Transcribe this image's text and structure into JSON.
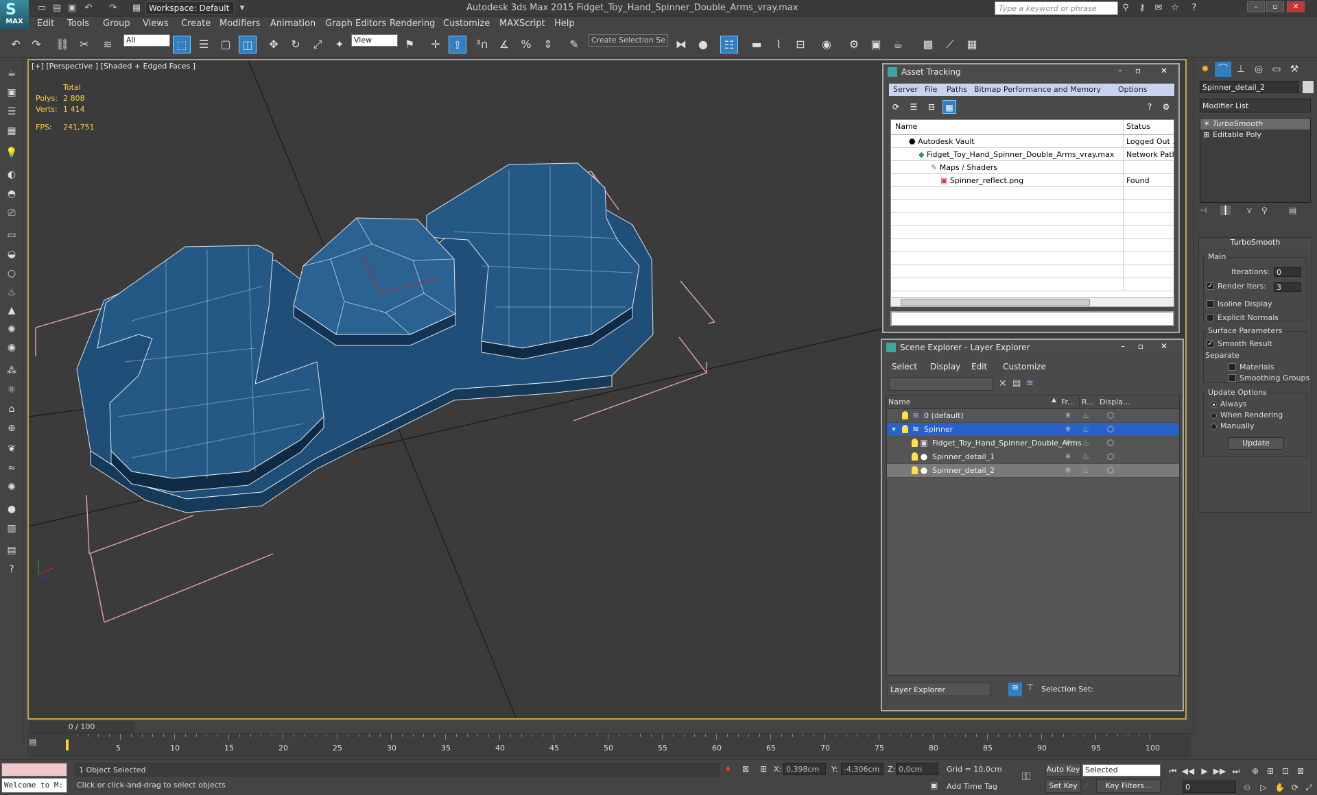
{
  "titlebar": {
    "app_name": "MAX",
    "workspace": "Workspace: Default",
    "window_title": "Autodesk 3ds Max 2015     Fidget_Toy_Hand_Spinner_Double_Arms_vray.max",
    "search_placeholder": "Type a keyword or phrase"
  },
  "menu": [
    "Edit",
    "Tools",
    "Group",
    "Views",
    "Create",
    "Modifiers",
    "Animation",
    "Graph Editors",
    "Rendering",
    "Customize",
    "MAXScript",
    "Help"
  ],
  "toolbar": {
    "selection_filter": "All",
    "ref_coord": "View",
    "selection_set": "Create Selection Se"
  },
  "viewport": {
    "label": "[+] [Perspective ] [Shaded + Edged Faces ]",
    "stats_header": "Total",
    "polys_label": "Polys:",
    "polys_value": "2 808",
    "verts_label": "Verts:",
    "verts_value": "1 414",
    "fps_label": "FPS:",
    "fps_value": "241,751",
    "model_color": "#1f4f78"
  },
  "asset_tracking": {
    "title": "Asset Tracking",
    "menu": [
      "Server",
      "File",
      "Paths",
      "Bitmap Performance and Memory",
      "Options"
    ],
    "col_name": "Name",
    "col_status": "Status",
    "rows": [
      {
        "name": "Autodesk Vault",
        "status": "Logged Out ..."
      },
      {
        "name": "Fidget_Toy_Hand_Spinner_Double_Arms_vray.max",
        "status": "Network Path"
      },
      {
        "name": "Maps / Shaders",
        "status": ""
      },
      {
        "name": "Spinner_reflect.png",
        "status": "Found"
      }
    ]
  },
  "scene_explorer": {
    "title": "Scene Explorer - Layer Explorer",
    "menu": [
      "Select",
      "Display",
      "Edit",
      "Customize"
    ],
    "col_name": "Name",
    "col_freeze": "Fr...",
    "col_render": "R...",
    "col_display": "Displa...",
    "rows": [
      {
        "name": "0 (default)"
      },
      {
        "name": "Spinner"
      },
      {
        "name": "Fidget_Toy_Hand_Spinner_Double_Arms"
      },
      {
        "name": "Spinner_detail_1"
      },
      {
        "name": "Spinner_detail_2"
      }
    ],
    "explorer_type": "Layer Explorer",
    "selection_set_label": "Selection Set:"
  },
  "command_panel": {
    "object_name": "Spinner_detail_2",
    "modifier_list": "Modifier List",
    "stack": [
      "TurboSmooth",
      "Editable Poly"
    ],
    "rollout_title": "TurboSmooth",
    "main_label": "Main",
    "iterations_label": "Iterations:",
    "iterations_value": "0",
    "render_iters_label": "Render Iters:",
    "render_iters_value": "3",
    "isoline_label": "Isoline Display",
    "explicit_normals_label": "Explicit Normals",
    "surface_params_label": "Surface Parameters",
    "smooth_result_label": "Smooth Result",
    "separate_label": "Separate",
    "materials_label": "Materials",
    "smoothing_groups_label": "Smoothing Groups",
    "update_options_label": "Update Options",
    "always_label": "Always",
    "when_rendering_label": "When Rendering",
    "manually_label": "Manually",
    "update_button": "Update"
  },
  "timeline": {
    "slider_text": "0 / 100",
    "ticks": [
      "5",
      "10",
      "15",
      "20",
      "25",
      "30",
      "35",
      "40",
      "45",
      "50",
      "55",
      "60",
      "65",
      "70",
      "75",
      "80",
      "85",
      "90",
      "95",
      "100"
    ]
  },
  "status": {
    "maxscript_text": "Welcome to M:",
    "selection": "1 Object Selected",
    "prompt": "Click or click-and-drag to select objects",
    "x_label": "X:",
    "x_value": "0,398cm",
    "y_label": "Y:",
    "y_value": "-4,306cm",
    "z_label": "Z:",
    "z_value": "0,0cm",
    "grid": "Grid = 10,0cm",
    "add_time_tag": "Add Time Tag",
    "auto_key": "Auto Key",
    "set_key": "Set Key",
    "key_mode": "Selected",
    "key_filters": "Key Filters...",
    "frame": "0"
  }
}
